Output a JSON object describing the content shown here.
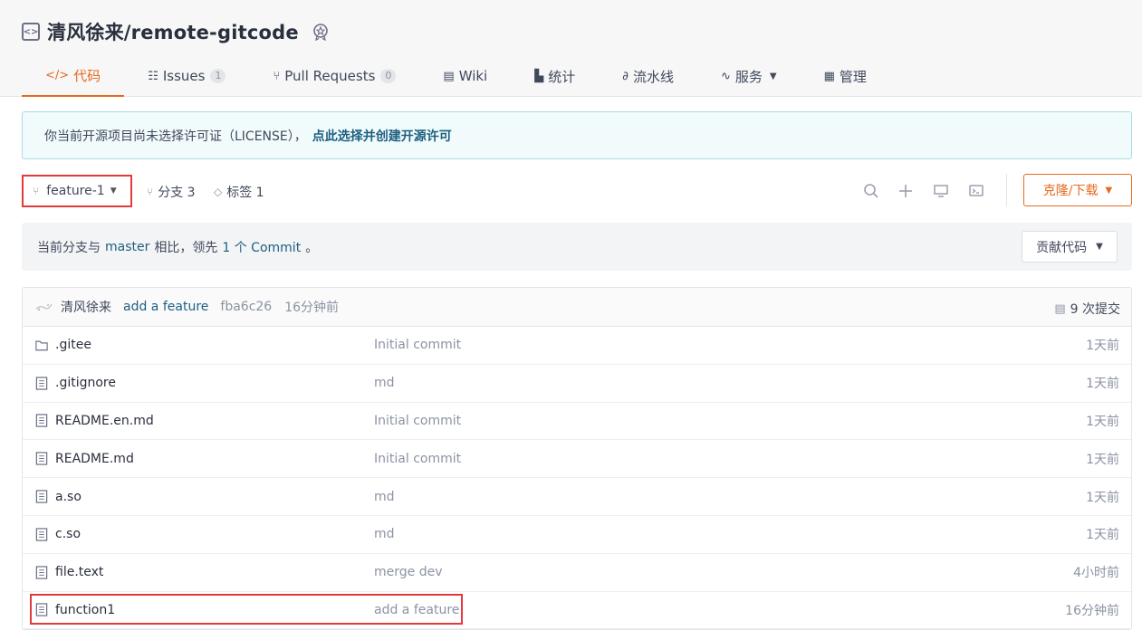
{
  "repo": {
    "name": "清风徐来/remote-gitcode"
  },
  "tabs": [
    {
      "label": "代码",
      "icon": "code-icon"
    },
    {
      "label": "Issues",
      "icon": "issues-icon",
      "count": "1"
    },
    {
      "label": "Pull Requests",
      "icon": "pull-request-icon",
      "count": "0"
    },
    {
      "label": "Wiki",
      "icon": "book-icon"
    },
    {
      "label": "统计",
      "icon": "chart-icon"
    },
    {
      "label": "流水线",
      "icon": "pipeline-icon"
    },
    {
      "label": "服务",
      "icon": "pulse-icon"
    },
    {
      "label": "管理",
      "icon": "settings-doc-icon"
    }
  ],
  "license": {
    "text": "你当前开源项目尚未选择许可证（LICENSE），",
    "link": "点此选择并创建开源许可"
  },
  "toolbar": {
    "branch": "feature-1",
    "branches_label": "分支 3",
    "tags_label": "标签 1",
    "clone_label": "克隆/下载"
  },
  "compare": {
    "prefix": "当前分支与",
    "base": "master",
    "middle": "相比，领先",
    "ahead": "1 个 Commit",
    "suffix": "。",
    "contribute_label": "贡献代码"
  },
  "last_commit": {
    "author": "清风徐来",
    "message": "add a feature",
    "sha": "fba6c26",
    "time": "16分钟前",
    "total": "9 次提交"
  },
  "files": [
    {
      "name": ".gitee",
      "type": "folder",
      "message": "Initial commit",
      "time": "1天前"
    },
    {
      "name": ".gitignore",
      "type": "file",
      "message": "md",
      "time": "1天前"
    },
    {
      "name": "README.en.md",
      "type": "file",
      "message": "Initial commit",
      "time": "1天前"
    },
    {
      "name": "README.md",
      "type": "file",
      "message": "Initial commit",
      "time": "1天前"
    },
    {
      "name": "a.so",
      "type": "file",
      "message": "md",
      "time": "1天前"
    },
    {
      "name": "c.so",
      "type": "file",
      "message": "md",
      "time": "1天前"
    },
    {
      "name": "file.text",
      "type": "file",
      "message": "merge dev",
      "time": "4小时前"
    },
    {
      "name": "function1",
      "type": "file",
      "message": "add a feature",
      "time": "16分钟前"
    }
  ],
  "colors": {
    "accent": "#e66a1d",
    "link": "#1d5f80",
    "highlight": "#e33b3b"
  }
}
